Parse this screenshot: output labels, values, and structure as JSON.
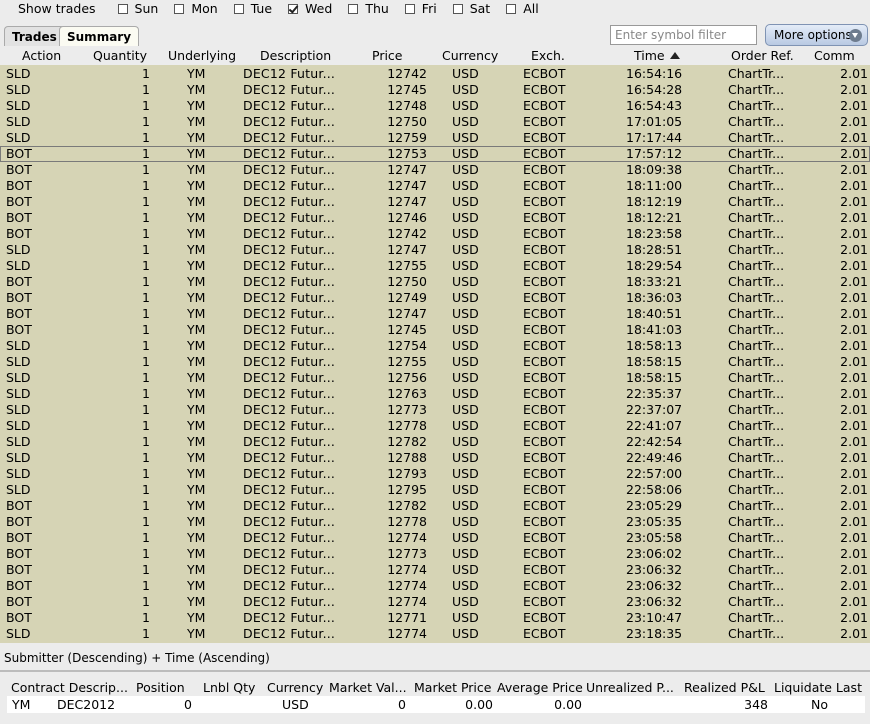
{
  "days": {
    "label": "Show trades",
    "items": [
      {
        "label": "Sun",
        "checked": false
      },
      {
        "label": "Mon",
        "checked": false
      },
      {
        "label": "Tue",
        "checked": false
      },
      {
        "label": "Wed",
        "checked": true
      },
      {
        "label": "Thu",
        "checked": false
      },
      {
        "label": "Fri",
        "checked": false
      },
      {
        "label": "Sat",
        "checked": false
      },
      {
        "label": "All",
        "checked": false
      }
    ]
  },
  "tabs": {
    "trades": "Trades",
    "summary": "Summary"
  },
  "symbol_filter": {
    "placeholder": "Enter symbol filter",
    "value": ""
  },
  "more_options": {
    "label": "More options",
    "icon": "chevron-down-icon"
  },
  "trades_table": {
    "columns": {
      "action": "Action",
      "quantity": "Quantity",
      "underlying": "Underlying",
      "description": "Description",
      "price": "Price",
      "currency": "Currency",
      "exch": "Exch.",
      "time": "Time",
      "order_ref": "Order Ref.",
      "comm": "Comm"
    },
    "sort_icon": "sort-ascending-icon",
    "selected_row": 5,
    "rows": [
      [
        "SLD",
        "1",
        "YM",
        "DEC12 Futur...",
        "12742",
        "USD",
        "ECBOT",
        "16:54:16",
        "ChartTr...",
        "2.01"
      ],
      [
        "SLD",
        "1",
        "YM",
        "DEC12 Futur...",
        "12745",
        "USD",
        "ECBOT",
        "16:54:28",
        "ChartTr...",
        "2.01"
      ],
      [
        "SLD",
        "1",
        "YM",
        "DEC12 Futur...",
        "12748",
        "USD",
        "ECBOT",
        "16:54:43",
        "ChartTr...",
        "2.01"
      ],
      [
        "SLD",
        "1",
        "YM",
        "DEC12 Futur...",
        "12750",
        "USD",
        "ECBOT",
        "17:01:05",
        "ChartTr...",
        "2.01"
      ],
      [
        "SLD",
        "1",
        "YM",
        "DEC12 Futur...",
        "12759",
        "USD",
        "ECBOT",
        "17:17:44",
        "ChartTr...",
        "2.01"
      ],
      [
        "BOT",
        "1",
        "YM",
        "DEC12 Futur...",
        "12753",
        "USD",
        "ECBOT",
        "17:57:12",
        "ChartTr...",
        "2.01"
      ],
      [
        "BOT",
        "1",
        "YM",
        "DEC12 Futur...",
        "12747",
        "USD",
        "ECBOT",
        "18:09:38",
        "ChartTr...",
        "2.01"
      ],
      [
        "BOT",
        "1",
        "YM",
        "DEC12 Futur...",
        "12747",
        "USD",
        "ECBOT",
        "18:11:00",
        "ChartTr...",
        "2.01"
      ],
      [
        "BOT",
        "1",
        "YM",
        "DEC12 Futur...",
        "12747",
        "USD",
        "ECBOT",
        "18:12:19",
        "ChartTr...",
        "2.01"
      ],
      [
        "BOT",
        "1",
        "YM",
        "DEC12 Futur...",
        "12746",
        "USD",
        "ECBOT",
        "18:12:21",
        "ChartTr...",
        "2.01"
      ],
      [
        "BOT",
        "1",
        "YM",
        "DEC12 Futur...",
        "12742",
        "USD",
        "ECBOT",
        "18:23:58",
        "ChartTr...",
        "2.01"
      ],
      [
        "SLD",
        "1",
        "YM",
        "DEC12 Futur...",
        "12747",
        "USD",
        "ECBOT",
        "18:28:51",
        "ChartTr...",
        "2.01"
      ],
      [
        "SLD",
        "1",
        "YM",
        "DEC12 Futur...",
        "12755",
        "USD",
        "ECBOT",
        "18:29:54",
        "ChartTr...",
        "2.01"
      ],
      [
        "BOT",
        "1",
        "YM",
        "DEC12 Futur...",
        "12750",
        "USD",
        "ECBOT",
        "18:33:21",
        "ChartTr...",
        "2.01"
      ],
      [
        "BOT",
        "1",
        "YM",
        "DEC12 Futur...",
        "12749",
        "USD",
        "ECBOT",
        "18:36:03",
        "ChartTr...",
        "2.01"
      ],
      [
        "BOT",
        "1",
        "YM",
        "DEC12 Futur...",
        "12747",
        "USD",
        "ECBOT",
        "18:40:51",
        "ChartTr...",
        "2.01"
      ],
      [
        "BOT",
        "1",
        "YM",
        "DEC12 Futur...",
        "12745",
        "USD",
        "ECBOT",
        "18:41:03",
        "ChartTr...",
        "2.01"
      ],
      [
        "SLD",
        "1",
        "YM",
        "DEC12 Futur...",
        "12754",
        "USD",
        "ECBOT",
        "18:58:13",
        "ChartTr...",
        "2.01"
      ],
      [
        "SLD",
        "1",
        "YM",
        "DEC12 Futur...",
        "12755",
        "USD",
        "ECBOT",
        "18:58:15",
        "ChartTr...",
        "2.01"
      ],
      [
        "SLD",
        "1",
        "YM",
        "DEC12 Futur...",
        "12756",
        "USD",
        "ECBOT",
        "18:58:15",
        "ChartTr...",
        "2.01"
      ],
      [
        "SLD",
        "1",
        "YM",
        "DEC12 Futur...",
        "12763",
        "USD",
        "ECBOT",
        "22:35:37",
        "ChartTr...",
        "2.01"
      ],
      [
        "SLD",
        "1",
        "YM",
        "DEC12 Futur...",
        "12773",
        "USD",
        "ECBOT",
        "22:37:07",
        "ChartTr...",
        "2.01"
      ],
      [
        "SLD",
        "1",
        "YM",
        "DEC12 Futur...",
        "12778",
        "USD",
        "ECBOT",
        "22:41:07",
        "ChartTr...",
        "2.01"
      ],
      [
        "SLD",
        "1",
        "YM",
        "DEC12 Futur...",
        "12782",
        "USD",
        "ECBOT",
        "22:42:54",
        "ChartTr...",
        "2.01"
      ],
      [
        "SLD",
        "1",
        "YM",
        "DEC12 Futur...",
        "12788",
        "USD",
        "ECBOT",
        "22:49:46",
        "ChartTr...",
        "2.01"
      ],
      [
        "SLD",
        "1",
        "YM",
        "DEC12 Futur...",
        "12793",
        "USD",
        "ECBOT",
        "22:57:00",
        "ChartTr...",
        "2.01"
      ],
      [
        "SLD",
        "1",
        "YM",
        "DEC12 Futur...",
        "12795",
        "USD",
        "ECBOT",
        "22:58:06",
        "ChartTr...",
        "2.01"
      ],
      [
        "BOT",
        "1",
        "YM",
        "DEC12 Futur...",
        "12782",
        "USD",
        "ECBOT",
        "23:05:29",
        "ChartTr...",
        "2.01"
      ],
      [
        "BOT",
        "1",
        "YM",
        "DEC12 Futur...",
        "12778",
        "USD",
        "ECBOT",
        "23:05:35",
        "ChartTr...",
        "2.01"
      ],
      [
        "BOT",
        "1",
        "YM",
        "DEC12 Futur...",
        "12774",
        "USD",
        "ECBOT",
        "23:05:58",
        "ChartTr...",
        "2.01"
      ],
      [
        "BOT",
        "1",
        "YM",
        "DEC12 Futur...",
        "12773",
        "USD",
        "ECBOT",
        "23:06:02",
        "ChartTr...",
        "2.01"
      ],
      [
        "BOT",
        "1",
        "YM",
        "DEC12 Futur...",
        "12774",
        "USD",
        "ECBOT",
        "23:06:32",
        "ChartTr...",
        "2.01"
      ],
      [
        "BOT",
        "1",
        "YM",
        "DEC12 Futur...",
        "12774",
        "USD",
        "ECBOT",
        "23:06:32",
        "ChartTr...",
        "2.01"
      ],
      [
        "BOT",
        "1",
        "YM",
        "DEC12 Futur...",
        "12774",
        "USD",
        "ECBOT",
        "23:06:32",
        "ChartTr...",
        "2.01"
      ],
      [
        "BOT",
        "1",
        "YM",
        "DEC12 Futur...",
        "12771",
        "USD",
        "ECBOT",
        "23:10:47",
        "ChartTr...",
        "2.01"
      ],
      [
        "SLD",
        "1",
        "YM",
        "DEC12 Futur...",
        "12774",
        "USD",
        "ECBOT",
        "23:18:35",
        "ChartTr...",
        "2.01"
      ]
    ]
  },
  "sort_status": "Submitter (Descending)  +  Time (Ascending)",
  "summary_table": {
    "columns": {
      "contract": "Contract Descrip...",
      "position": "Position",
      "lnbl_qty": "Lnbl Qty",
      "currency": "Currency",
      "market_value": "Market Val...",
      "market_price": "Market Price",
      "average_price": "Average Price",
      "unrealized_pnl": "Unrealized P...",
      "realized_pnl": "Realized P&L",
      "liquidate_last": "Liquidate Last"
    },
    "row": {
      "symbol": "YM",
      "expiry": "DEC2012",
      "position": "0",
      "lnbl_qty": "",
      "currency": "USD",
      "market_value": "0",
      "market_price": "0.00",
      "average_price": "0.00",
      "unrealized_pnl": "",
      "realized_pnl": "348",
      "liquidate_last": "No"
    }
  },
  "colors": {
    "grid_bg": "#d6d4b5",
    "panel_bg": "#ececec",
    "button_accent": "#b9c9e2"
  }
}
